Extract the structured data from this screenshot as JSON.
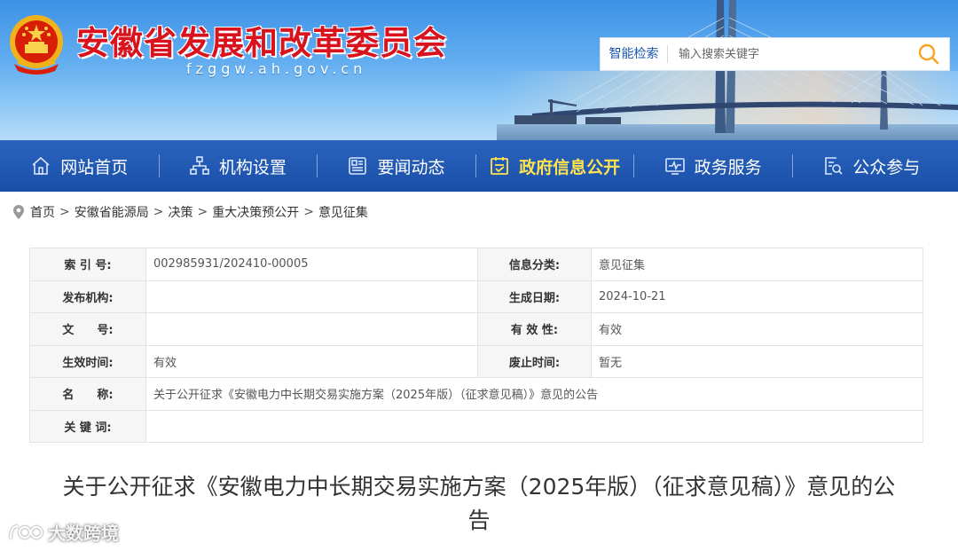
{
  "header": {
    "site_title": "安徽省发展和改革委员会",
    "site_domain": "fzggw.ah.gov.cn",
    "search_label": "智能检索",
    "search_placeholder": "输入搜索关键字"
  },
  "nav": [
    {
      "label": "网站首页",
      "icon": "home-icon"
    },
    {
      "label": "机构设置",
      "icon": "org-chart-icon"
    },
    {
      "label": "要闻动态",
      "icon": "newspaper-icon"
    },
    {
      "label": "政府信息公开",
      "icon": "info-disclosure-icon",
      "active": true
    },
    {
      "label": "政务服务",
      "icon": "monitor-icon"
    },
    {
      "label": "公众参与",
      "icon": "participation-icon"
    }
  ],
  "breadcrumb": [
    "首页",
    "安徽省能源局",
    "决策",
    "重大决策预公开",
    "意见征集"
  ],
  "breadcrumb_separator": ">",
  "info_table": {
    "index_label": "索 引 号:",
    "index_value": "002985931/202410-00005",
    "category_label": "信息分类:",
    "category_value": "意见征集",
    "issuer_label": "发布机构:",
    "issuer_value": "",
    "date_label": "生成日期:",
    "date_value": "2024-10-21",
    "docno_label": "文　　号:",
    "docno_value": "",
    "validity_label": "有 效 性:",
    "validity_value": "有效",
    "effective_label": "生效时间:",
    "effective_value": "有效",
    "expire_label": "废止时间:",
    "expire_value": "暂无",
    "name_label": "名　　称:",
    "name_value": "关于公开征求《安徽电力中长期交易实施方案（2025年版）（征求意见稿）》意见的公告",
    "keywords_label": "关 键 词:",
    "keywords_value": ""
  },
  "article": {
    "title": "关于公开征求《安徽电力中长期交易实施方案（2025年版）（征求意见稿）》意见的公告"
  },
  "watermark": {
    "text": "大数跨境"
  },
  "colors": {
    "nav_bg": "#1a4fa7",
    "nav_active_text": "#ffe34f",
    "title_red": "#d9131d",
    "search_label": "#1b57b1",
    "search_icon": "#f5a623"
  }
}
